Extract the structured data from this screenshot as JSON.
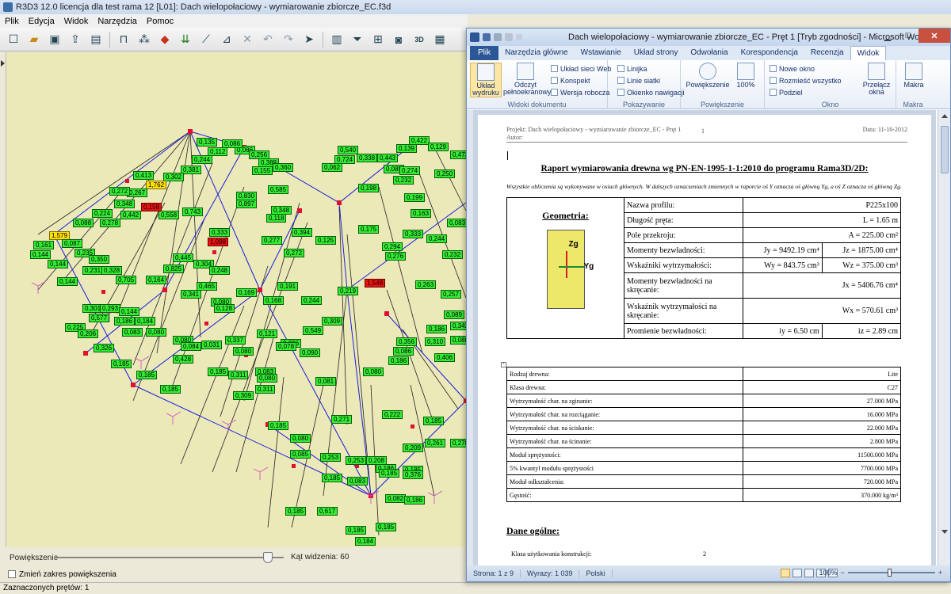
{
  "r3d3": {
    "title": "R3D3 12.0 licencja dla test rama 12 [L01]: Dach wielopołaciowy - wymiarowanie zbiorcze_EC.f3d",
    "menu": [
      "Plik",
      "Edycja",
      "Widok",
      "Narzędzia",
      "Pomoc"
    ],
    "zoom_label": "Powiększenie",
    "zoom_level": 0.93,
    "angle_label": "Kąt widzenia: 60",
    "zoom_range_label": "Zmień zakres powiększenia",
    "status": "Zaznaczonych prętów: 1",
    "colors": {
      "label_ok": "#33ee33",
      "label_warn": "#ffe000",
      "label_fail": "#ee1111",
      "member": "#1a1ae0",
      "node": "#e01030"
    },
    "model_labels": [
      {
        "t": "0,618",
        "c": "g"
      },
      {
        "t": "1,906",
        "c": "y"
      },
      {
        "t": "0,086",
        "c": "g"
      },
      {
        "t": "0,112",
        "c": "g"
      },
      {
        "t": "0,244",
        "c": "g"
      },
      {
        "t": "0,381",
        "c": "g"
      },
      {
        "t": "0,256",
        "c": "g"
      },
      {
        "t": "0,388",
        "c": "g"
      },
      {
        "t": "0,155",
        "c": "g"
      },
      {
        "t": "0,360",
        "c": "g"
      },
      {
        "t": "0,302",
        "c": "g"
      },
      {
        "t": "1,762",
        "c": "y"
      },
      {
        "t": "0,413",
        "c": "g"
      },
      {
        "t": "0,267",
        "c": "g"
      },
      {
        "t": "0,272",
        "c": "g"
      },
      {
        "t": "0,348",
        "c": "g"
      },
      {
        "t": "0,224",
        "c": "g"
      },
      {
        "t": "0,088",
        "c": "g"
      },
      {
        "t": "0,278",
        "c": "g"
      },
      {
        "t": "0,442",
        "c": "g"
      },
      {
        "t": "0,558",
        "c": "g"
      },
      {
        "t": "0,743",
        "c": "g"
      },
      {
        "t": "0,158",
        "c": "r"
      },
      {
        "t": "1,579",
        "c": "y"
      },
      {
        "t": "0,161",
        "c": "g"
      },
      {
        "t": "0,144",
        "c": "g"
      },
      {
        "t": "0,087",
        "c": "g"
      },
      {
        "t": "0,235",
        "c": "g"
      },
      {
        "t": "0,144",
        "c": "g"
      },
      {
        "t": "0,350",
        "c": "g"
      },
      {
        "t": "0,231",
        "c": "g"
      },
      {
        "t": "0,328",
        "c": "g"
      },
      {
        "t": "0,144",
        "c": "g"
      },
      {
        "t": "0,705",
        "c": "g"
      },
      {
        "t": "0,164",
        "c": "g"
      },
      {
        "t": "0,825",
        "c": "g"
      },
      {
        "t": "0,445",
        "c": "g"
      },
      {
        "t": "0,333",
        "c": "g"
      },
      {
        "t": "1,098",
        "c": "r"
      },
      {
        "t": "0,897",
        "c": "g"
      },
      {
        "t": "0,830",
        "c": "g"
      },
      {
        "t": "0,585",
        "c": "g"
      },
      {
        "t": "0,348",
        "c": "g"
      },
      {
        "t": "0,118",
        "c": "g"
      },
      {
        "t": "0,394",
        "c": "g"
      },
      {
        "t": "0,277",
        "c": "g"
      },
      {
        "t": "0,272",
        "c": "g"
      },
      {
        "t": "0,125",
        "c": "g"
      },
      {
        "t": "0,175",
        "c": "g"
      },
      {
        "t": "0,540",
        "c": "g"
      },
      {
        "t": "0,338",
        "c": "g"
      },
      {
        "t": "0,443",
        "c": "g"
      },
      {
        "t": "0,422",
        "c": "g"
      },
      {
        "t": "0,139",
        "c": "g"
      },
      {
        "t": "0,129",
        "c": "g"
      },
      {
        "t": "0,473",
        "c": "g"
      },
      {
        "t": "0,062",
        "c": "g"
      },
      {
        "t": "0,724",
        "c": "g"
      },
      {
        "t": "0,085",
        "c": "g"
      },
      {
        "t": "0,274",
        "c": "g"
      },
      {
        "t": "0,250",
        "c": "g"
      },
      {
        "t": "0,198",
        "c": "g"
      },
      {
        "t": "0,232",
        "c": "g"
      },
      {
        "t": "0,199",
        "c": "g"
      },
      {
        "t": "0,163",
        "c": "g"
      },
      {
        "t": "0,083",
        "c": "g"
      },
      {
        "t": "0,333",
        "c": "g"
      },
      {
        "t": "0,244",
        "c": "g"
      },
      {
        "t": "0,294",
        "c": "g"
      },
      {
        "t": "0,276",
        "c": "g"
      },
      {
        "t": "0,232",
        "c": "g"
      },
      {
        "t": "0,263",
        "c": "g"
      },
      {
        "t": "0,257",
        "c": "g"
      },
      {
        "t": "0,219",
        "c": "g"
      },
      {
        "t": "1,548",
        "c": "r"
      },
      {
        "t": "0,304",
        "c": "g"
      },
      {
        "t": "0,248",
        "c": "g"
      },
      {
        "t": "0,465",
        "c": "g"
      },
      {
        "t": "0,341",
        "c": "g"
      },
      {
        "t": "0,080",
        "c": "g"
      },
      {
        "t": "0,128",
        "c": "g"
      },
      {
        "t": "0,169",
        "c": "g"
      },
      {
        "t": "0,168",
        "c": "g"
      },
      {
        "t": "0,191",
        "c": "g"
      },
      {
        "t": "0,244",
        "c": "g"
      },
      {
        "t": "0,309",
        "c": "g"
      },
      {
        "t": "0,549",
        "c": "g"
      },
      {
        "t": "0,306",
        "c": "g"
      },
      {
        "t": "0,083",
        "c": "g"
      },
      {
        "t": "0,311",
        "c": "g"
      },
      {
        "t": "0,080",
        "c": "g"
      },
      {
        "t": "0,428",
        "c": "g"
      },
      {
        "t": "0,084",
        "c": "g"
      },
      {
        "t": "0,031",
        "c": "g"
      },
      {
        "t": "0,337",
        "c": "g"
      },
      {
        "t": "0,080",
        "c": "g"
      },
      {
        "t": "0,121",
        "c": "g"
      },
      {
        "t": "0,078",
        "c": "g"
      },
      {
        "t": "0,090",
        "c": "g"
      },
      {
        "t": "0,080",
        "c": "g"
      },
      {
        "t": "0,309",
        "c": "g"
      },
      {
        "t": "0,311",
        "c": "g"
      },
      {
        "t": "0,081",
        "c": "g"
      },
      {
        "t": "0,080",
        "c": "g"
      },
      {
        "t": "0,301",
        "c": "g"
      },
      {
        "t": "0,293",
        "c": "g"
      },
      {
        "t": "0,144",
        "c": "g"
      },
      {
        "t": "0,577",
        "c": "g"
      },
      {
        "t": "0,186",
        "c": "g"
      },
      {
        "t": "0,184",
        "c": "g"
      },
      {
        "t": "0,083",
        "c": "g"
      },
      {
        "t": "0,080",
        "c": "g"
      },
      {
        "t": "0,225",
        "c": "g"
      },
      {
        "t": "0,206",
        "c": "g"
      },
      {
        "t": "0,326",
        "c": "g"
      },
      {
        "t": "0,185",
        "c": "g"
      },
      {
        "t": "0,185",
        "c": "g"
      },
      {
        "t": "0,185",
        "c": "g"
      },
      {
        "t": "0,185",
        "c": "g"
      },
      {
        "t": "0,185",
        "c": "g"
      },
      {
        "t": "0,080",
        "c": "g"
      },
      {
        "t": "0,085",
        "c": "g"
      },
      {
        "t": "0,271",
        "c": "g"
      },
      {
        "t": "0,222",
        "c": "g"
      },
      {
        "t": "0,253",
        "c": "g"
      },
      {
        "t": "0,253",
        "c": "g"
      },
      {
        "t": "0,208",
        "c": "g"
      },
      {
        "t": "0,186",
        "c": "g"
      },
      {
        "t": "0,185",
        "c": "g"
      },
      {
        "t": "0,185",
        "c": "g"
      },
      {
        "t": "0,185",
        "c": "g"
      },
      {
        "t": "0,083",
        "c": "g"
      },
      {
        "t": "0,082",
        "c": "g"
      },
      {
        "t": "0,186",
        "c": "g"
      },
      {
        "t": "0,617",
        "c": "g"
      },
      {
        "t": "0,185",
        "c": "g"
      },
      {
        "t": "0,185",
        "c": "g"
      },
      {
        "t": "0,185",
        "c": "g"
      },
      {
        "t": "0,184",
        "c": "g"
      },
      {
        "t": "0,376",
        "c": "g"
      },
      {
        "t": "0,185",
        "c": "g"
      },
      {
        "t": "0,278",
        "c": "g"
      },
      {
        "t": "0,261",
        "c": "g"
      },
      {
        "t": "0,209",
        "c": "g"
      },
      {
        "t": "0,186",
        "c": "g"
      },
      {
        "t": "0,186",
        "c": "g"
      },
      {
        "t": "0,356",
        "c": "g"
      },
      {
        "t": "0,310",
        "c": "g"
      },
      {
        "t": "0,406",
        "c": "g"
      },
      {
        "t": "0,342",
        "c": "g"
      },
      {
        "t": "0,088",
        "c": "g"
      },
      {
        "t": "0,089",
        "c": "g"
      },
      {
        "t": "0,086",
        "c": "g"
      },
      {
        "t": "0,135",
        "c": "g"
      },
      {
        "t": "0,086",
        "c": "g"
      }
    ]
  },
  "word": {
    "title": "Dach wielopołaciowy - wymiarowanie zbiorcze_EC - Pręt 1 [Tryb zgodności] - Microsoft Word",
    "tabs": [
      "Plik",
      "Narzędzia główne",
      "Wstawianie",
      "Układ strony",
      "Odwołania",
      "Korespondencja",
      "Recenzja",
      "Widok"
    ],
    "active_tab": "Widok",
    "ribbon": {
      "print_layout": "Układ wydruku",
      "full_screen": "Odczyt pełnoekranowy",
      "web_layout": "Układ sieci Web",
      "outline": "Konspekt",
      "draft": "Wersja robocza",
      "group_views": "Widoki dokumentu",
      "ruler": "Linijka",
      "gridlines": "Linie siatki",
      "nav_pane": "Okienko nawigacji",
      "group_show": "Pokazywanie",
      "zoom": "Powiększenie",
      "zoom_100": "100%",
      "group_zoom": "Powiększenie",
      "new_window": "Nowe okno",
      "arrange_all": "Rozmieść wszystko",
      "split": "Podziel",
      "switch_windows": "Przełącz okna",
      "group_window": "Okno",
      "macros": "Makra",
      "group_macros": "Makra"
    },
    "page": {
      "header_project": "Projekt: Dach wielopołaciowy - wymiarowanie zbiorcze_EC - Pręt 1",
      "header_author": "Autor:",
      "header_page": "1",
      "header_date": "Data: 11-10-2012",
      "title": "Raport wymiarowania drewna wg PN-EN-1995-1-1:2010 do programu Rama3D/2D:",
      "intro": "Wszystkie obliczenia są wykonywane w osiach głównych. W dalszych oznaczeniach zmiennych w raporcie oś Y oznacza oś główną Yg, a oś Z oznacza oś główną Zg.",
      "geometry_title": "Geometria:",
      "axis_z": "Zg",
      "axis_y": "Yg",
      "geometry": [
        {
          "label": "Nazwa profilu:",
          "v1": "",
          "v2": "P225x100"
        },
        {
          "label": "Długość pręta:",
          "v1": "",
          "v2": "L = 1.65 m"
        },
        {
          "label": "Pole przekroju:",
          "v1": "",
          "v2": "A = 225.00 cm²"
        },
        {
          "label": "Momenty bezwładności:",
          "v1": "Jy = 9492.19 cm⁴",
          "v2": "Jz = 1875.00 cm⁴"
        },
        {
          "label": "Wskaźniki wytrzymałości:",
          "v1": "Wy = 843.75 cm³",
          "v2": "Wz = 375.00 cm³"
        },
        {
          "label": "Momenty bezwładności na skręcanie:",
          "v1": "",
          "v2": "Jx = 5406.76 cm⁴"
        },
        {
          "label": "Wskaźnik wytrzymałości na skręcanie:",
          "v1": "",
          "v2": "Wx = 570.61 cm³"
        },
        {
          "label": "Promienie bezwładności:",
          "v1": "iy = 6.50 cm",
          "v2": "iz = 2.89 cm"
        }
      ],
      "material": [
        {
          "label": "Rodzaj drewna:",
          "value": "Lite"
        },
        {
          "label": "Klasa drewna:",
          "value": "C27"
        },
        {
          "label": "Wytrzymałość char. na zginanie:",
          "value": "27.000 MPa"
        },
        {
          "label": "Wytrzymałość char. na rozciąganie:",
          "value": "16.000 MPa"
        },
        {
          "label": "Wytrzymałość char. na ściskanie:",
          "value": "22.000 MPa"
        },
        {
          "label": "Wytrzymałość char. na ścinanie:",
          "value": "2.800 MPa"
        },
        {
          "label": "Moduł sprężystości:",
          "value": "11500.000 MPa"
        },
        {
          "label": "5% kwantyl modułu sprężystości",
          "value": "7700.000 MPa"
        },
        {
          "label": "Moduł odkształcenia:",
          "value": "720.000 MPa"
        },
        {
          "label": "Gęstość:",
          "value": "370.000 kg/m³"
        }
      ],
      "section_general": "Dane ogólne:",
      "service_class_label": "Klasa użytkowania konstrukcji:",
      "service_class_value": "2"
    },
    "status": {
      "page": "Strona: 1 z 9",
      "words": "Wyrazy: 1 039",
      "language": "Polski",
      "zoom": "100%"
    }
  }
}
